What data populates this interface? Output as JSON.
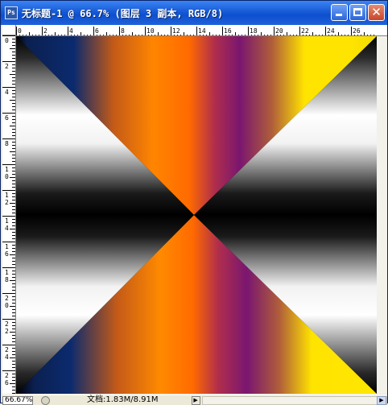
{
  "window": {
    "title": "无标题-1 @ 66.7% (图层 3 副本, RGB/8)",
    "app_icon": "Ps",
    "buttons": {
      "minimize_icon": "minimize-icon",
      "maximize_icon": "maximize-icon",
      "close_icon": "close-icon"
    }
  },
  "rulers": {
    "horizontal_labels": [
      "0",
      "2",
      "4",
      "6",
      "8",
      "10",
      "12",
      "14",
      "16",
      "18",
      "20",
      "22",
      "24",
      "26"
    ],
    "vertical_labels": [
      "0",
      "2",
      "4",
      "6",
      "8",
      "10",
      "12",
      "14",
      "16",
      "18",
      "20",
      "22",
      "24",
      "26"
    ]
  },
  "canvas": {
    "description_colors": {
      "navy": "#0b2a6e",
      "orange": "#ff7a00",
      "purple": "#7a1670",
      "yellow": "#ffe400",
      "white": "#ffffff",
      "black": "#000000"
    }
  },
  "status": {
    "zoom": "66.67%",
    "doc_info": "文档:1.83M/8.91M",
    "arrow_glyph": "▶"
  }
}
